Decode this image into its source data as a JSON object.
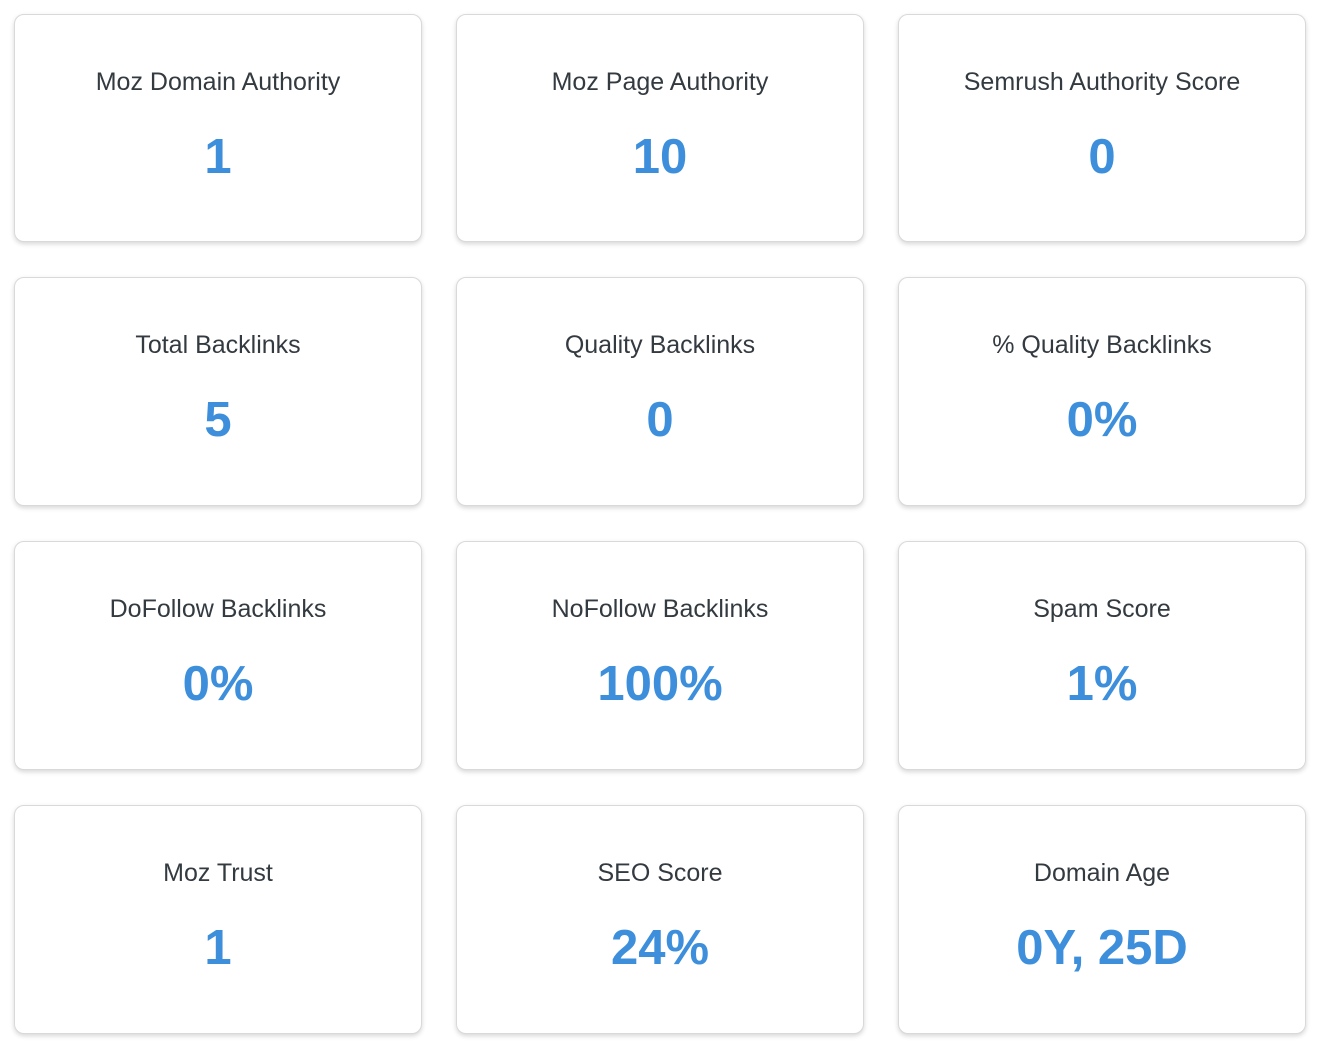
{
  "value_color": "#3d8fdc",
  "metrics": [
    {
      "label": "Moz Domain Authority",
      "value": "1"
    },
    {
      "label": "Moz Page Authority",
      "value": "10"
    },
    {
      "label": "Semrush Authority Score",
      "value": "0"
    },
    {
      "label": "Total Backlinks",
      "value": "5"
    },
    {
      "label": "Quality Backlinks",
      "value": "0"
    },
    {
      "label": "% Quality Backlinks",
      "value": "0%"
    },
    {
      "label": "DoFollow Backlinks",
      "value": "0%"
    },
    {
      "label": "NoFollow Backlinks",
      "value": "100%"
    },
    {
      "label": "Spam Score",
      "value": "1%"
    },
    {
      "label": "Moz Trust",
      "value": "1"
    },
    {
      "label": "SEO Score",
      "value": "24%"
    },
    {
      "label": "Domain Age",
      "value": "0Y, 25D"
    }
  ]
}
